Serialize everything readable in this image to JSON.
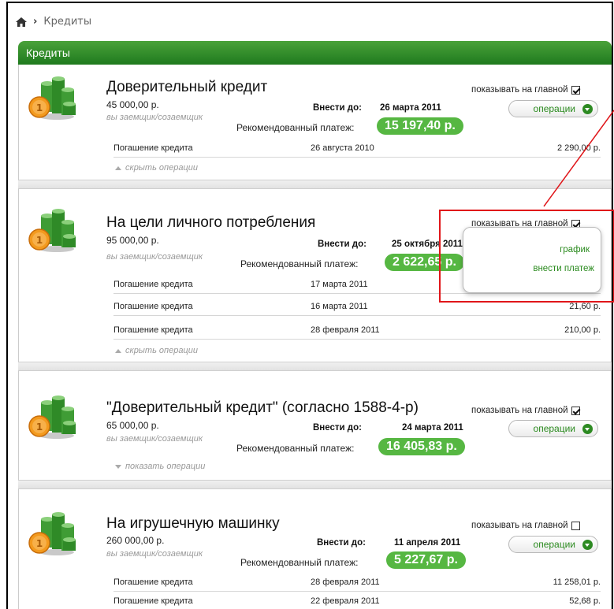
{
  "breadcrumb": {
    "current": "Кредиты"
  },
  "header": {
    "title": "Кредиты"
  },
  "labels": {
    "show_main": "показывать на главной",
    "operations": "операции",
    "due": "Внести до:",
    "recommended": "Рекомендованный платеж:",
    "hide_ops": "скрыть операции",
    "show_ops": "показать операции"
  },
  "credits": [
    {
      "title": "Доверительный кредит",
      "amount": "45 000,00 р.",
      "role": "вы заемщик/созаемщик",
      "due_date": "26 марта 2011",
      "payment": "15 197,40 р.",
      "show_main": true,
      "operations": [
        {
          "name": "Погашение кредита",
          "date": "26 августа 2010",
          "sum": "2 290,00 р."
        }
      ]
    },
    {
      "title": "На цели личного потребления",
      "amount": "95 000,00 р.",
      "role": "вы заемщик/созаемщик",
      "due_date": "25 октября 2011",
      "payment": "2 622,65 р.",
      "show_main": true,
      "operations": [
        {
          "name": "Погашение кредита",
          "date": "17 марта 2011",
          "sum": ""
        },
        {
          "name": "Погашение кредита",
          "date": "16 марта 2011",
          "sum": "21,60 р."
        },
        {
          "name": "Погашение кредита",
          "date": "28 февраля 2011",
          "sum": "210,00 р."
        }
      ]
    },
    {
      "title": "\"Доверительный кредит\" (согласно 1588-4-р)",
      "amount": "65 000,00 р.",
      "role": "вы заемщик/созаемщик",
      "due_date": "24 марта 2011",
      "payment": "16 405,83 р.",
      "show_main": true,
      "operations": []
    },
    {
      "title": "На игрушечную машинку",
      "amount": "260 000,00 р.",
      "role": "вы заемщик/созаемщик",
      "due_date": "11 апреля 2011",
      "payment": "5 227,67 р.",
      "show_main": false,
      "operations": [
        {
          "name": "Погашение кредита",
          "date": "28 февраля 2011",
          "sum": "11 258,01 р."
        },
        {
          "name": "Погашение кредита",
          "date": "22 февраля 2011",
          "sum": "52,68 р."
        }
      ]
    }
  ],
  "popup_menu": {
    "item1": "график",
    "item2": "внести платеж"
  },
  "colors": {
    "brand_green": "#2d8a22",
    "pill_green": "#56b742",
    "annotation_red": "#e0161a"
  }
}
